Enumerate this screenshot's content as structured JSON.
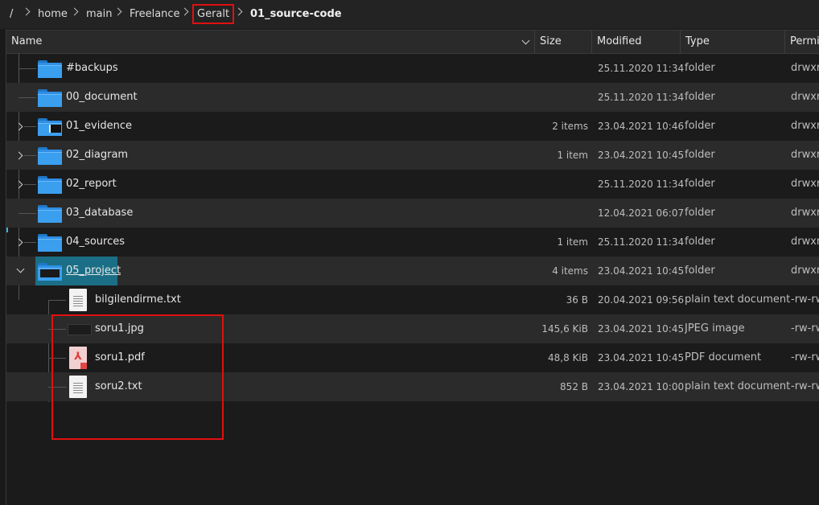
{
  "breadcrumb": {
    "root": "/",
    "items": [
      "home",
      "main",
      "Freelance",
      "Geralt"
    ],
    "current": "01_source-code"
  },
  "columns": {
    "name": "Name",
    "size": "Size",
    "modified": "Modified",
    "type": "Type",
    "permissions": "Permis"
  },
  "rows": [
    {
      "name": "#backups",
      "size": "",
      "modified": "25.11.2020 11:34",
      "type": "folder",
      "permissions": "drwxrw"
    },
    {
      "name": "00_document",
      "size": "",
      "modified": "25.11.2020 11:34",
      "type": "folder",
      "permissions": "drwxrw"
    },
    {
      "name": "01_evidence",
      "size": "2 items",
      "modified": "23.04.2021 10:46",
      "type": "folder",
      "permissions": "drwxrw"
    },
    {
      "name": "02_diagram",
      "size": "1 item",
      "modified": "23.04.2021 10:45",
      "type": "folder",
      "permissions": "drwxrw"
    },
    {
      "name": "02_report",
      "size": "",
      "modified": "25.11.2020 11:34",
      "type": "folder",
      "permissions": "drwxrw"
    },
    {
      "name": "03_database",
      "size": "",
      "modified": "12.04.2021 06:07",
      "type": "folder",
      "permissions": "drwxrw"
    },
    {
      "name": "04_sources",
      "size": "1 item",
      "modified": "25.11.2020 11:34",
      "type": "folder",
      "permissions": "drwxrw"
    },
    {
      "name": "05_project",
      "size": "4 items",
      "modified": "23.04.2021 10:45",
      "type": "folder",
      "permissions": "drwxrw"
    },
    {
      "name": "bilgilendirme.txt",
      "size": "36 B",
      "modified": "20.04.2021 09:56",
      "type": "plain text document",
      "permissions": "-rw-rw"
    },
    {
      "name": "soru1.jpg",
      "size": "145,6 KiB",
      "modified": "23.04.2021 10:45",
      "type": "JPEG image",
      "permissions": "-rw-rw"
    },
    {
      "name": "soru1.pdf",
      "size": "48,8 KiB",
      "modified": "23.04.2021 10:45",
      "type": "PDF document",
      "permissions": "-rw-rw"
    },
    {
      "name": "soru2.txt",
      "size": "852 B",
      "modified": "23.04.2021 10:00",
      "type": "plain text document",
      "permissions": "-rw-rw"
    }
  ],
  "colors": {
    "background": "#1b1b1b",
    "alt_row": "#2b2b2b",
    "selection": "#1a6f86",
    "folder": "#3b9ff0",
    "annotation": "#e01010"
  }
}
